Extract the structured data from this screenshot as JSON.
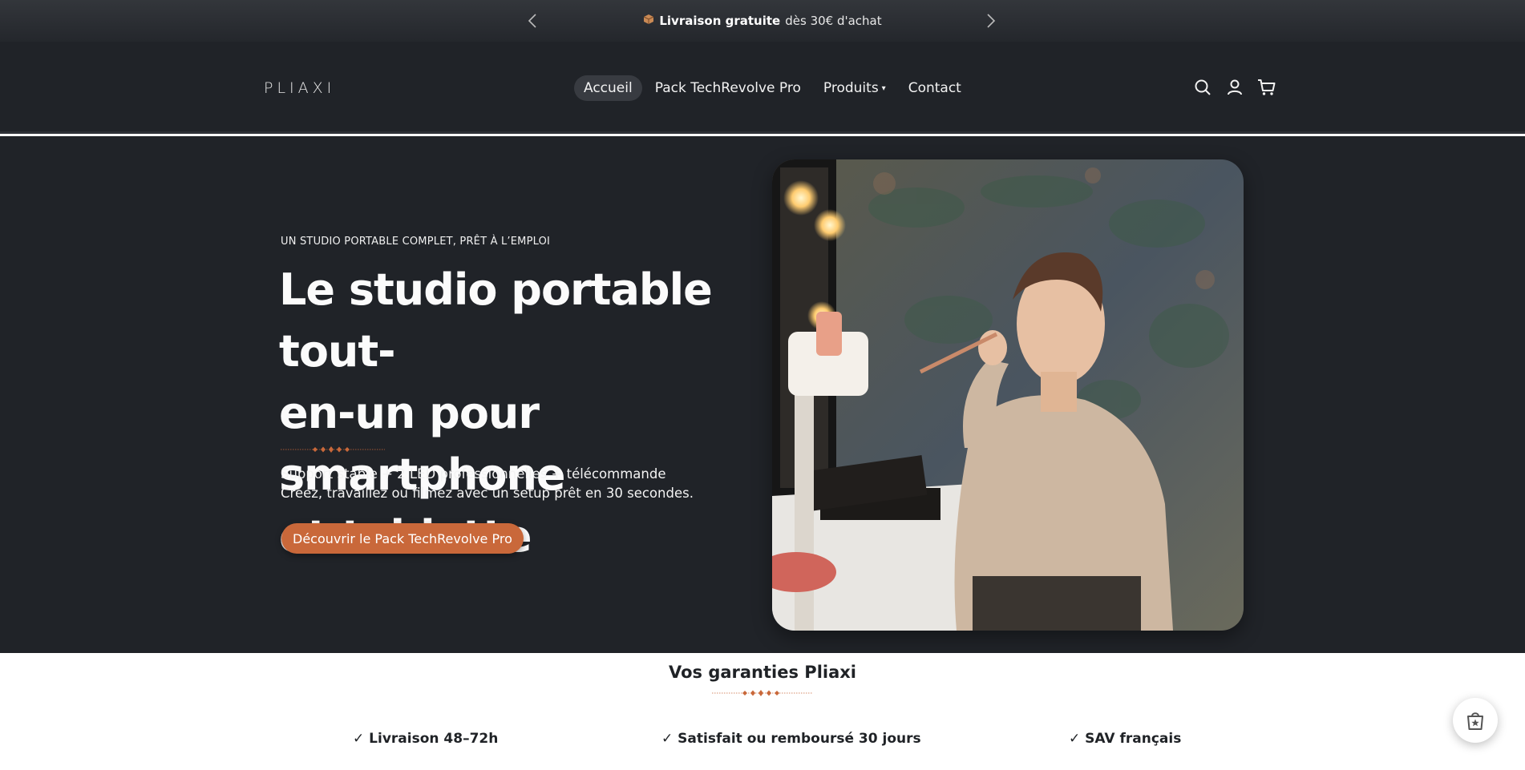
{
  "announcement": {
    "box_icon": "package-icon",
    "bold": "Livraison gratuite",
    "rest": "dès 30€ d'achat"
  },
  "header": {
    "logo": "PLIAXI",
    "nav": [
      {
        "label": "Accueil",
        "active": true
      },
      {
        "label": "Pack TechRevolve Pro"
      },
      {
        "label": "Produits",
        "dropdown": true
      },
      {
        "label": "Contact"
      }
    ],
    "icons": [
      "search-icon",
      "account-icon",
      "cart-icon"
    ]
  },
  "hero": {
    "eyebrow": "UN STUDIO PORTABLE COMPLET, PRÊT À L’EMPLOI",
    "headline_1": "Le studio portable tout-",
    "headline_2": "en-un pour smartphone",
    "headline_3": "et tablette",
    "sub_1": "Support stable + 2 LED professionnelles + télécommande",
    "sub_2": "Créez, travaillez ou filmez avec un setup prêt en 30 secondes.",
    "cta": "Découvrir le Pack TechRevolve Pro"
  },
  "guarantees": {
    "title": "Vos garanties Pliaxi",
    "items": [
      "✓ Livraison 48–72h",
      "✓ Satisfait ou remboursé 30 jours",
      "✓ SAV français"
    ]
  },
  "colors": {
    "accent": "#c9683a",
    "dark_bg": "#202328"
  }
}
